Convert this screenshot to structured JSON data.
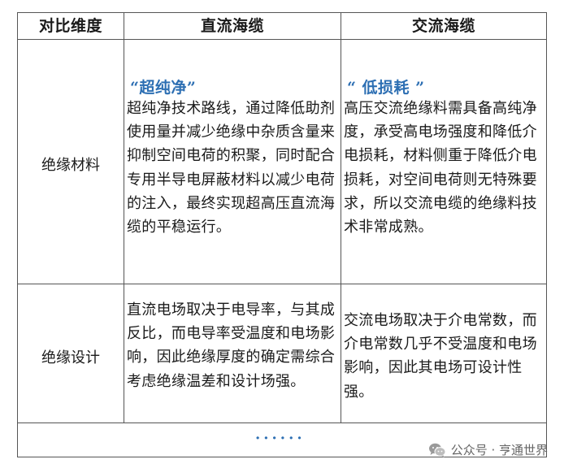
{
  "table": {
    "headers": [
      "对比维度",
      "直流海缆",
      "交流海缆"
    ],
    "rows": [
      {
        "label": "绝缘材料",
        "dc_highlight": "“超纯净”",
        "dc_text": "超纯净技术路线，通过降低助剂使用量并减少绝缘中杂质含量来抑制空间电荷的积聚，同时配合专用半导电屏蔽材料以减少电荷的注入，最终实现超高压直流海缆的平稳运行。",
        "ac_highlight": "“ 低损耗 ”",
        "ac_text": "高压交流绝缘料需具备高纯净度，承受高电场强度和降低介电损耗，材料侧重于降低介电损耗，对空间电荷则无特殊要求，所以交流电缆的绝缘料技术非常成熟。"
      },
      {
        "label": "绝缘设计",
        "dc_text": "直流电场取决于电导率，与其成反比，而电导率受温度和电场影响，因此绝缘厚度的确定需综合考虑绝缘温差和设计场强。",
        "ac_text": "交流电场取决于介电常数，而介电常数几乎不受温度和电场影响，因此其电场可设计性强。"
      }
    ],
    "continuation": "······"
  },
  "watermark": {
    "text": "公众号 · 亨通世界",
    "icon": "wechat-icon"
  },
  "colors": {
    "highlight": "#2d6fb3",
    "border": "#555555"
  }
}
